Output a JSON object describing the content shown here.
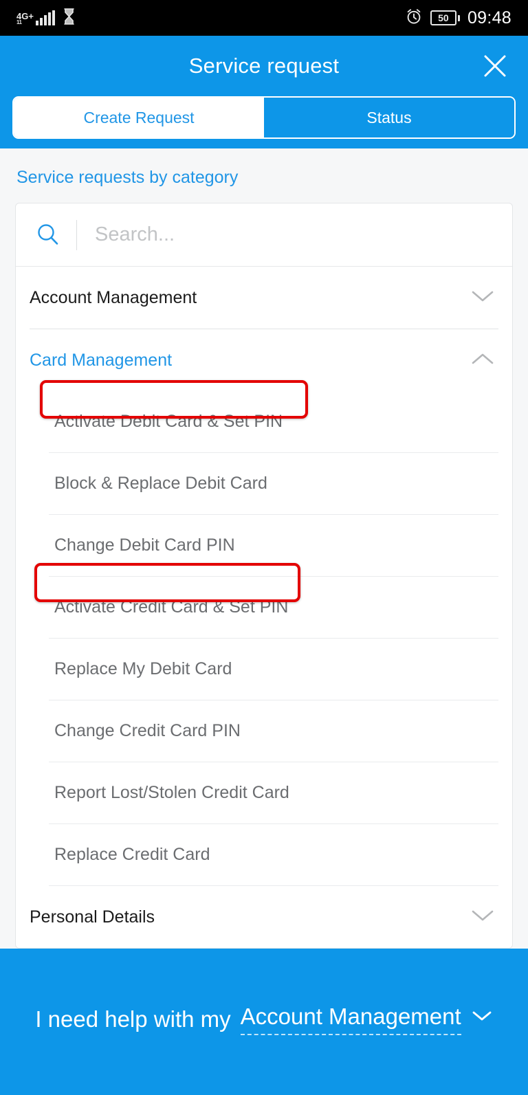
{
  "status_bar": {
    "network": "4G",
    "network_plus": "+",
    "network_sub": "11",
    "hourglass_icon": "hourglass-icon",
    "alarm_icon": "alarm-clock-icon",
    "battery_level": "50",
    "time": "09:48"
  },
  "header": {
    "title": "Service request",
    "close_icon": "close-icon"
  },
  "tabs": [
    {
      "label": "Create Request",
      "active": true
    },
    {
      "label": "Status",
      "active": false
    }
  ],
  "main": {
    "section_title": "Service requests by category",
    "search": {
      "placeholder": "Search...",
      "value": "",
      "icon": "search-icon"
    },
    "categories": [
      {
        "label": "Account Management",
        "expanded": false,
        "chevron": "chevron-down-icon",
        "items": []
      },
      {
        "label": "Card Management",
        "expanded": true,
        "chevron": "chevron-up-icon",
        "items": [
          {
            "label": "Activate Debit Card & Set PIN",
            "highlighted": true
          },
          {
            "label": "Block & Replace Debit Card",
            "highlighted": false
          },
          {
            "label": "Change Debit Card PIN",
            "highlighted": false
          },
          {
            "label": "Activate Credit Card & Set PIN",
            "highlighted": true
          },
          {
            "label": "Replace My Debit Card",
            "highlighted": false
          },
          {
            "label": "Change Credit Card PIN",
            "highlighted": false
          },
          {
            "label": "Report Lost/Stolen Credit Card",
            "highlighted": false
          },
          {
            "label": "Replace Credit Card",
            "highlighted": false
          }
        ]
      },
      {
        "label": "Personal Details",
        "expanded": false,
        "chevron": "chevron-down-icon",
        "items": []
      }
    ]
  },
  "footer": {
    "prefix": "I need help with my",
    "selected_category": "Account Management",
    "chevron": "chevron-down-icon"
  },
  "colors": {
    "brand_blue": "#0d96e8",
    "link_blue": "#2196e6",
    "annotation_red": "#e30000",
    "page_bg": "#f6f7f8",
    "text_dark": "#1b1b1b",
    "text_muted": "#6b6d70"
  }
}
